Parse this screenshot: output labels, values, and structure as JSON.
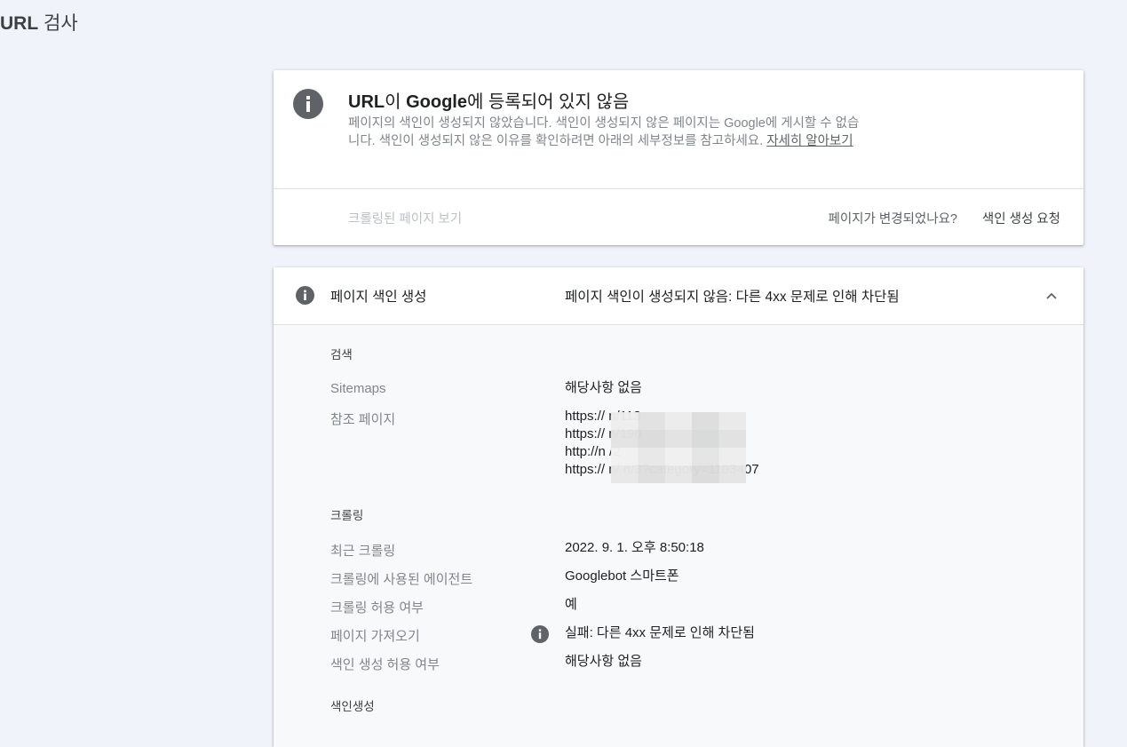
{
  "page": {
    "title_prefix": "URL",
    "title_suffix": "검사"
  },
  "status_card": {
    "title_url": "URL",
    "title_mid": "이 ",
    "title_google": "Google",
    "title_rest": "에 등록되어 있지 않음",
    "description": "페이지의 색인이 생성되지 않았습니다. 색인이 생성되지 않은 페이지는 Google에 게시할 수 없습니다. 색인이 생성되지 않은 이유를 확인하려면 아래의 세부정보를 참고하세요.",
    "learn_more": "자세히 알아보기",
    "view_crawled_page": "크롤링된 페이지 보기",
    "page_changed_question": "페이지가 변경되었나요?",
    "request_indexing": "색인 생성 요청"
  },
  "detail_card": {
    "header_label": "페이지 색인 생성",
    "header_status": "페이지 색인이 생성되지 않음: 다른 4xx 문제로 인해 차단됨",
    "discovery": {
      "heading": "검색",
      "sitemaps_label": "Sitemaps",
      "sitemaps_value": "해당사항 없음",
      "referring_label": "참조 페이지",
      "referring_pages": [
        "https://                                 n/113",
        "https://                                 n/196",
        "http://n                                  /2",
        "https://                                 n/ n/3?category=1103407"
      ]
    },
    "crawl": {
      "heading": "크롤링",
      "last_crawl_label": "최근 크롤링",
      "last_crawl_value": "2022. 9. 1. 오후 8:50:18",
      "agent_label": "크롤링에 사용된 에이전트",
      "agent_value": "Googlebot 스마트폰",
      "crawl_allowed_label": "크롤링 허용 여부",
      "crawl_allowed_value": "예",
      "page_fetch_label": "페이지 가져오기",
      "page_fetch_value": "실패: 다른 4xx 문제로 인해 차단됨",
      "indexing_allowed_label": "색인 생성 허용 여부",
      "indexing_allowed_value": "해당사항 없음"
    },
    "indexing": {
      "heading": "색인생성"
    }
  }
}
